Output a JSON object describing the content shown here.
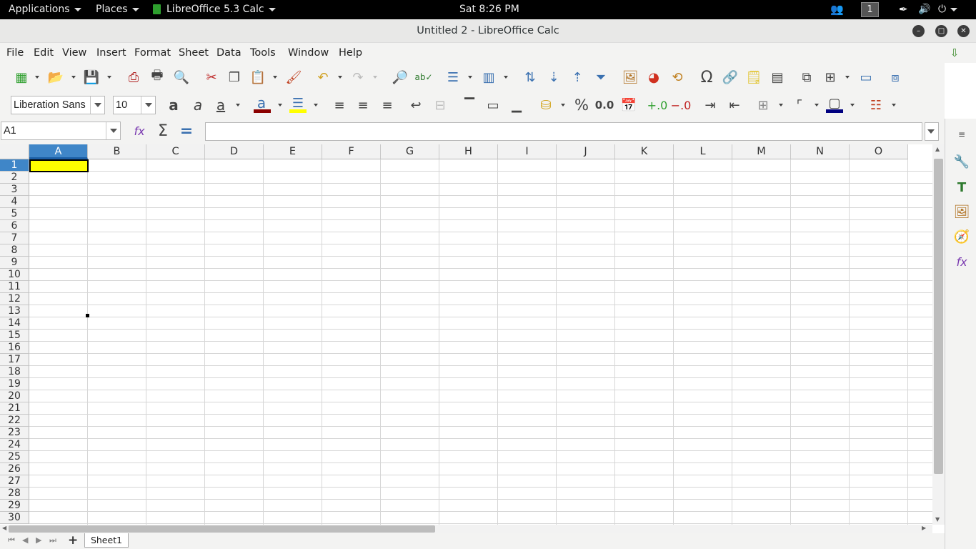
{
  "topbar": {
    "applications": "Applications",
    "places": "Places",
    "app_name": "LibreOffice 5.3 Calc",
    "clock": "Sat  8:26 PM",
    "workspace": "1"
  },
  "window": {
    "title": "Untitled 2 - LibreOffice Calc"
  },
  "menu": {
    "items": [
      "File",
      "Edit",
      "View",
      "Insert",
      "Format",
      "Sheet",
      "Data",
      "Tools",
      "Window",
      "Help"
    ]
  },
  "format_toolbar": {
    "font_name": "Liberation Sans",
    "font_size": "10",
    "font_color": "#8b0000",
    "highlight_color": "#ffff00",
    "border_color": "#000080"
  },
  "formula_bar": {
    "name_box": "A1",
    "formula": ""
  },
  "grid": {
    "columns": [
      "A",
      "B",
      "C",
      "D",
      "E",
      "F",
      "G",
      "H",
      "I",
      "J",
      "K",
      "L",
      "M",
      "N",
      "O"
    ],
    "rows": [
      "1",
      "2",
      "3",
      "4",
      "5",
      "6",
      "7",
      "8",
      "9",
      "10",
      "11",
      "12",
      "13",
      "14",
      "15",
      "16",
      "17",
      "18",
      "19",
      "20",
      "21",
      "22",
      "23",
      "24",
      "25",
      "26",
      "27",
      "28",
      "29",
      "30"
    ],
    "selected_cell": "A1",
    "selected_fill": "#ffff00"
  },
  "tabs": {
    "sheets": [
      "Sheet1"
    ]
  }
}
